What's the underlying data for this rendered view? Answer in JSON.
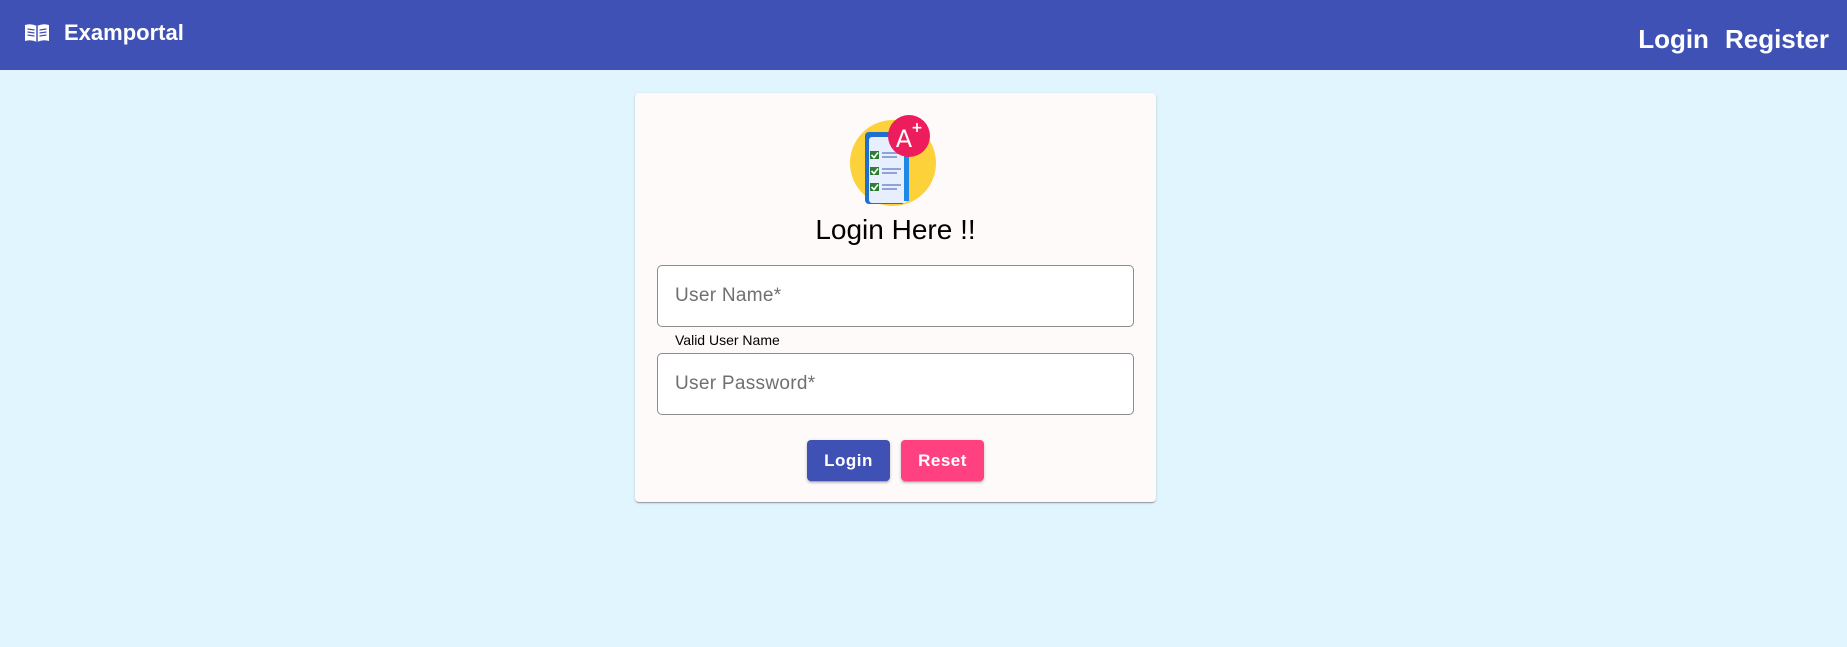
{
  "app": {
    "brand": "Examportal",
    "brand_icon": "book-open-icon"
  },
  "nav": {
    "login_label": "Login",
    "register_label": "Register"
  },
  "login_card": {
    "logo_icon": "exam-grade-a-plus-icon",
    "title": "Login Here !!",
    "username": {
      "value": "",
      "placeholder": "User Name*"
    },
    "username_hint": "Valid User Name",
    "password": {
      "value": "",
      "placeholder": "User Password*"
    },
    "login_button": "Login",
    "reset_button": "Reset"
  },
  "colors": {
    "primary": "#3f51b5",
    "accent": "#ff4081",
    "background": "#e1f5fe",
    "card": "#fffafa"
  }
}
